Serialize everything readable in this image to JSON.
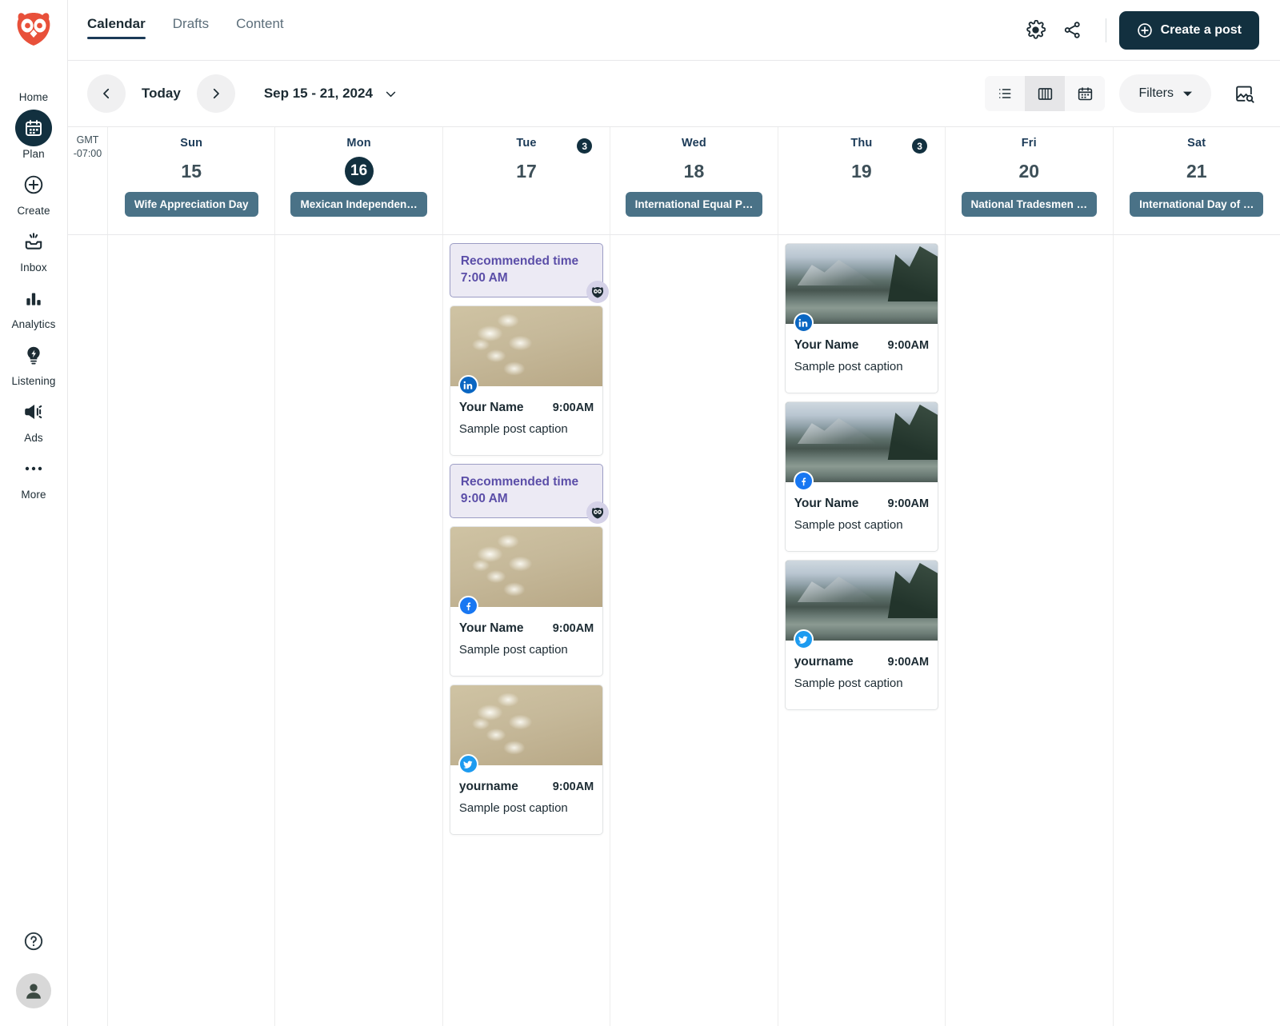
{
  "brand": {
    "logo": "hootsuite-owl-logo",
    "accent": "#12303f",
    "logo_color": "#e8503a"
  },
  "rail": {
    "items": [
      {
        "label": "Home",
        "icon": "home-owl-icon",
        "active": false
      },
      {
        "label": "Plan",
        "icon": "calendar-icon",
        "active": true
      },
      {
        "label": "Create",
        "icon": "plus-circle-icon",
        "active": false
      },
      {
        "label": "Inbox",
        "icon": "inbox-icon",
        "active": false
      },
      {
        "label": "Analytics",
        "icon": "bar-chart-icon",
        "active": false
      },
      {
        "label": "Listening",
        "icon": "lightbulb-icon",
        "active": false
      },
      {
        "label": "Ads",
        "icon": "megaphone-icon",
        "active": false
      },
      {
        "label": "More",
        "icon": "ellipsis-icon",
        "active": false
      }
    ],
    "help_icon": "question-circle-icon",
    "avatar_icon": "user-avatar-icon"
  },
  "topbar": {
    "tabs": [
      {
        "label": "Calendar",
        "active": true
      },
      {
        "label": "Drafts",
        "active": false
      },
      {
        "label": "Content",
        "active": false
      }
    ],
    "settings_icon": "gear-icon",
    "share_icon": "share-icon",
    "create_post_label": "Create a post",
    "create_post_icon": "plus-circle-icon"
  },
  "subbar": {
    "prev_icon": "chevron-left-icon",
    "next_icon": "chevron-right-icon",
    "today_label": "Today",
    "date_range": "Sep 15 - 21, 2024",
    "date_caret_icon": "chevron-down-icon",
    "views": [
      {
        "icon": "list-view-icon",
        "selected": false
      },
      {
        "icon": "week-column-view-icon",
        "selected": true
      },
      {
        "icon": "month-calendar-view-icon",
        "selected": false
      }
    ],
    "filters_label": "Filters",
    "filters_caret_icon": "caret-down-icon",
    "media_search_icon": "image-search-icon"
  },
  "calendar": {
    "timezone": {
      "line1": "GMT",
      "line2": "-07:00"
    },
    "days": [
      {
        "dow": "Sun",
        "num": "15",
        "today": false,
        "count": null,
        "holiday": "Wife Appreciation Day"
      },
      {
        "dow": "Mon",
        "num": "16",
        "today": true,
        "count": null,
        "holiday": "Mexican Independen…"
      },
      {
        "dow": "Tue",
        "num": "17",
        "today": false,
        "count": "3",
        "holiday": null
      },
      {
        "dow": "Wed",
        "num": "18",
        "today": false,
        "count": null,
        "holiday": "International Equal P…"
      },
      {
        "dow": "Thu",
        "num": "19",
        "today": false,
        "count": "3",
        "holiday": null
      },
      {
        "dow": "Fri",
        "num": "20",
        "today": false,
        "count": null,
        "holiday": "National Tradesmen …"
      },
      {
        "dow": "Sat",
        "num": "21",
        "today": false,
        "count": null,
        "holiday": "International Day of …"
      }
    ],
    "columns": [
      {
        "day": "Sun",
        "entries": []
      },
      {
        "day": "Mon",
        "entries": []
      },
      {
        "day": "Tue",
        "entries": [
          {
            "kind": "recommended",
            "title": "Recommended time",
            "time": "7:00 AM",
            "badge_icon": "owl-avatar-icon"
          },
          {
            "kind": "post",
            "network": "linkedin",
            "network_icon": "linkedin-icon",
            "image": "flower",
            "name": "Your Name",
            "time": "9:00AM",
            "caption": "Sample post caption"
          },
          {
            "kind": "recommended",
            "title": "Recommended time",
            "time": "9:00 AM",
            "badge_icon": "owl-avatar-icon"
          },
          {
            "kind": "post",
            "network": "facebook",
            "network_icon": "facebook-icon",
            "image": "flower",
            "name": "Your Name",
            "time": "9:00AM",
            "caption": "Sample post caption"
          },
          {
            "kind": "post",
            "network": "twitter",
            "network_icon": "twitter-icon",
            "image": "flower",
            "name": "yourname",
            "time": "9:00AM",
            "caption": "Sample post caption"
          }
        ]
      },
      {
        "day": "Wed",
        "entries": []
      },
      {
        "day": "Thu",
        "entries": [
          {
            "kind": "post",
            "network": "linkedin",
            "network_icon": "linkedin-icon",
            "image": "lake",
            "name": "Your Name",
            "time": "9:00AM",
            "caption": "Sample post caption"
          },
          {
            "kind": "post",
            "network": "facebook",
            "network_icon": "facebook-icon",
            "image": "lake",
            "name": "Your Name",
            "time": "9:00AM",
            "caption": "Sample post caption"
          },
          {
            "kind": "post",
            "network": "twitter",
            "network_icon": "twitter-icon",
            "image": "lake",
            "name": "yourname",
            "time": "9:00AM",
            "caption": "Sample post caption"
          }
        ]
      },
      {
        "day": "Fri",
        "entries": []
      },
      {
        "day": "Sat",
        "entries": []
      }
    ]
  }
}
